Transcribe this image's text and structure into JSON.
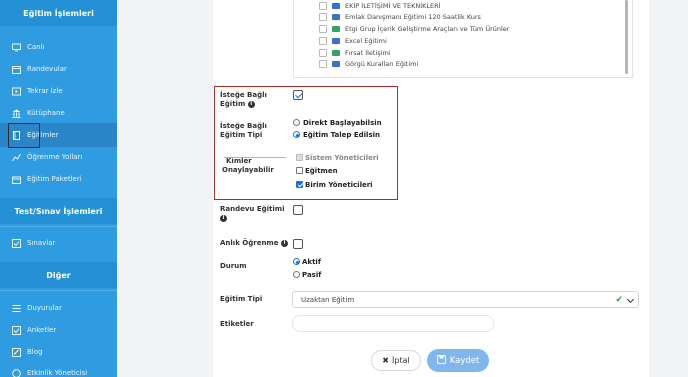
{
  "sidebar": {
    "section_egitim": "Eğitim İşlemleri",
    "section_test": "Test/Sınav İşlemleri",
    "section_diger": "Diğer",
    "items": [
      {
        "label": "Canlı",
        "icon": "monitor-icon"
      },
      {
        "label": "Randevular",
        "icon": "calendar-icon"
      },
      {
        "label": "Tekrar İzle",
        "icon": "replay-icon"
      },
      {
        "label": "Kütüphane",
        "icon": "library-icon"
      },
      {
        "label": "Eğitimler",
        "icon": "book-icon"
      },
      {
        "label": "Öğrenme Yolları",
        "icon": "path-icon"
      },
      {
        "label": "Eğitim Paketleri",
        "icon": "package-icon"
      },
      {
        "label": "Sınavlar",
        "icon": "exam-icon"
      },
      {
        "label": "Duyurular",
        "icon": "announcement-icon"
      },
      {
        "label": "Anketler",
        "icon": "survey-icon"
      },
      {
        "label": "Blog",
        "icon": "blog-icon"
      },
      {
        "label": "Etkinlik Yöneticisi",
        "icon": "event-icon"
      }
    ]
  },
  "tree": {
    "items": [
      {
        "label": "EKİP İLETİŞİMİ VE TEKNİKLERİ",
        "color": "#3a6fd8"
      },
      {
        "label": "Emlak Danışmanı Eğitimi 120 Saatlik Kurs",
        "color": "#3a6fd8"
      },
      {
        "label": "Etgi Grup İçerik Geliştirme Araçları ve Tüm Ürünler",
        "color": "#2fa36a"
      },
      {
        "label": "Excel Eğitimi",
        "color": "#3a6fd8"
      },
      {
        "label": "Fırsat İletişimi",
        "color": "#2fa36a"
      },
      {
        "label": "Görgü Kuralları Eğitimi",
        "color": "#3a6fd8"
      }
    ]
  },
  "form": {
    "optional_label_line1": "İsteğe Bağlı",
    "optional_label_line2": "Eğitim",
    "optional_type_line1": "İsteğe Bağlı",
    "optional_type_line2": "Eğitim Tipi",
    "radio_direct": "Direkt Başlayabilsin",
    "radio_request": "Eğitim Talep Edilsin",
    "approvers_line1": "Kimler",
    "approvers_line2": "Onaylayabilir",
    "approver_admins": "Sistem Yöneticileri",
    "approver_trainer": "Eğitmen",
    "approver_unit_managers": "Birim Yöneticileri",
    "appointment_training": "Randevu Eğitimi",
    "instant_learning": "Anlık Öğrenme",
    "status_label": "Durum",
    "status_active": "Aktif",
    "status_passive": "Pasif",
    "training_type_label": "Eğitim Tipi",
    "training_type_value": "Uzaktan Eğitim",
    "tags_label": "Etiketler",
    "cancel_label": "İptal",
    "save_label": "Kaydet"
  },
  "colors": {
    "sidebar_bg": "#2f9be0",
    "highlight_box": "#b02a2a",
    "save_button": "#7fb6ec",
    "accent": "#1e6fd9"
  }
}
